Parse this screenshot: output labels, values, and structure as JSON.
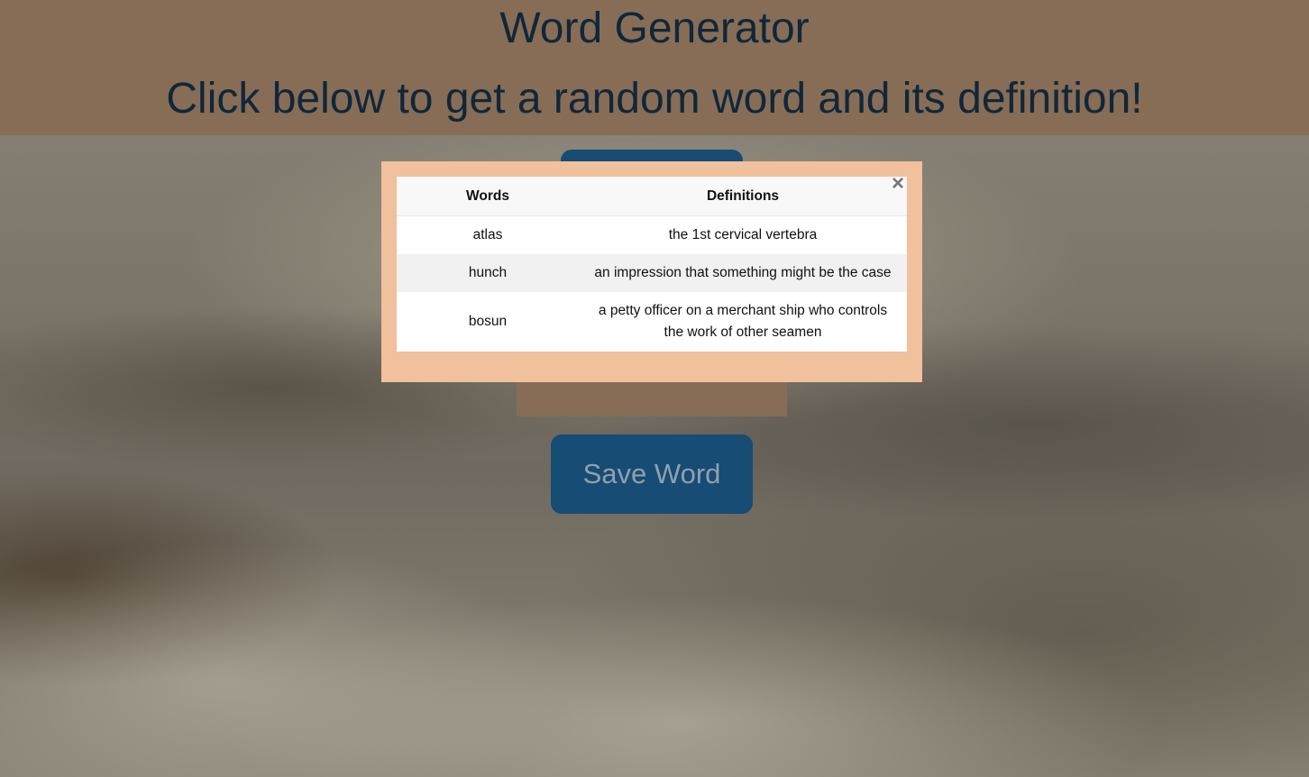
{
  "header": {
    "title": "Word Generator",
    "subtitle": "Click below to get a random word and its definition!"
  },
  "controls": {
    "save_label": "Save Word"
  },
  "modal": {
    "close_glyph": "×",
    "columns": [
      "Words",
      "Definitions"
    ],
    "rows": [
      {
        "word": "atlas",
        "definition": "the 1st cervical vertebra"
      },
      {
        "word": "hunch",
        "definition": "an impression that something might be the case"
      },
      {
        "word": "bosun",
        "definition": "a petty officer on a merchant ship who controls the work of other seamen"
      }
    ]
  },
  "colors": {
    "header_bg": "#876d56",
    "header_text": "#10273a",
    "button_bg": "#174c74",
    "button_text": "#8fa1ad",
    "modal_bg": "#f1c09c"
  }
}
